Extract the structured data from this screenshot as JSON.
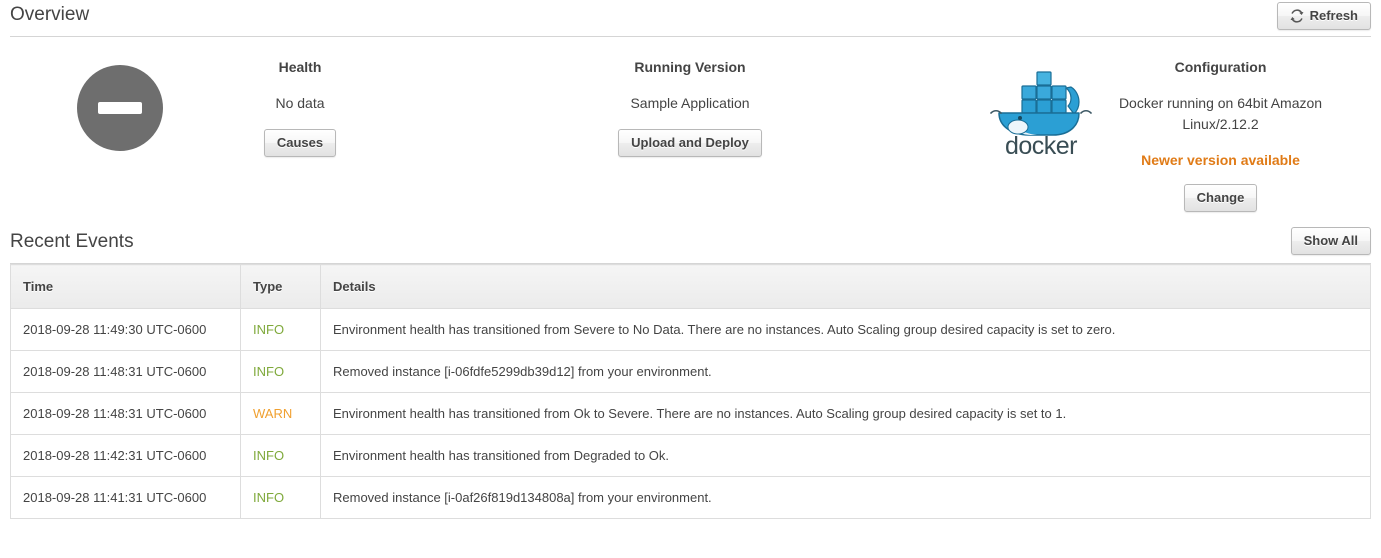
{
  "overview": {
    "title": "Overview",
    "refresh_label": "Refresh",
    "refresh_icon": "refresh-icon",
    "panels": {
      "health": {
        "heading": "Health",
        "value": "No data",
        "button_label": "Causes",
        "status_icon": "health-nodata-icon",
        "status_color": "#6e6e6e"
      },
      "version": {
        "heading": "Running Version",
        "value": "Sample Application",
        "button_label": "Upload and Deploy"
      },
      "configuration": {
        "heading": "Configuration",
        "value": "Docker running on 64bit Amazon Linux/2.12.2",
        "note": "Newer version available",
        "note_color": "#e07b17",
        "button_label": "Change",
        "platform_icon": "docker-logo-icon",
        "platform_wordmark": "docker"
      }
    }
  },
  "recent_events": {
    "title": "Recent Events",
    "show_all_label": "Show All",
    "columns": [
      "Time",
      "Type",
      "Details"
    ],
    "rows": [
      {
        "time": "2018-09-28 11:49:30 UTC-0600",
        "type": "INFO",
        "details": "Environment health has transitioned from Severe to No Data. There are no instances. Auto Scaling group desired capacity is set to zero."
      },
      {
        "time": "2018-09-28 11:48:31 UTC-0600",
        "type": "INFO",
        "details": "Removed instance [i-06fdfe5299db39d12] from your environment."
      },
      {
        "time": "2018-09-28 11:48:31 UTC-0600",
        "type": "WARN",
        "details": "Environment health has transitioned from Ok to Severe. There are no instances. Auto Scaling group desired capacity is set to 1."
      },
      {
        "time": "2018-09-28 11:42:31 UTC-0600",
        "type": "INFO",
        "details": "Environment health has transitioned from Degraded to Ok."
      },
      {
        "time": "2018-09-28 11:41:31 UTC-0600",
        "type": "INFO",
        "details": "Removed instance [i-0af26f819d134808a] from your environment."
      }
    ]
  },
  "colors": {
    "info": "#7fa93b",
    "warn": "#f0a030",
    "accent_orange": "#e07b17",
    "docker_blue": "#2496c8"
  }
}
